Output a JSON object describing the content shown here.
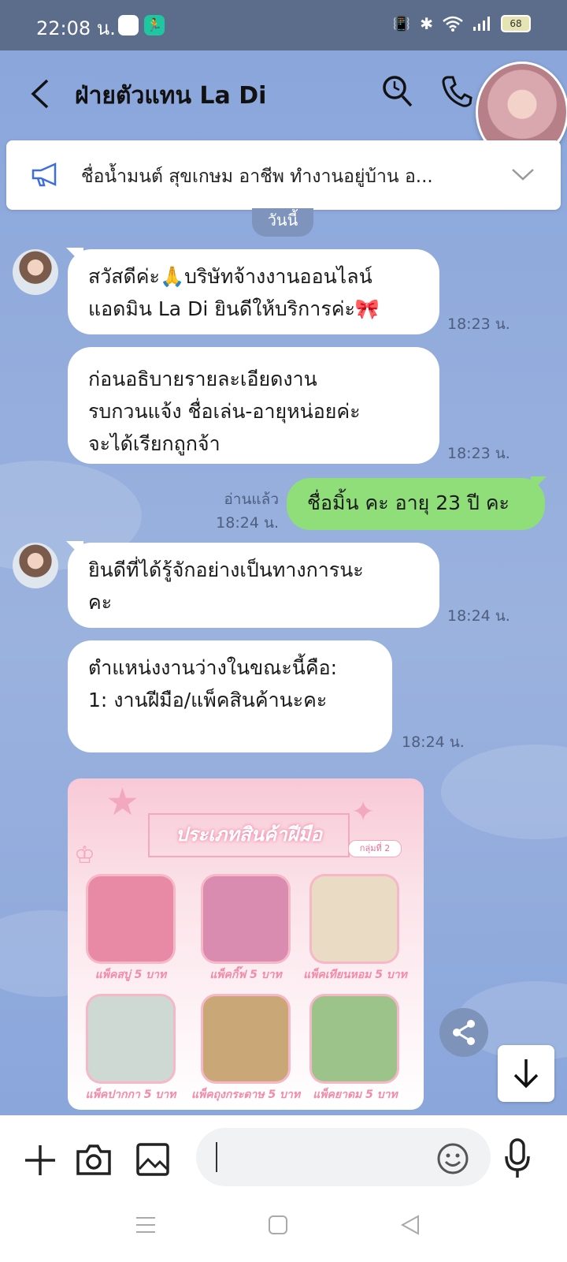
{
  "status_bar": {
    "time": "22:08 น.",
    "battery": "68"
  },
  "header": {
    "title": "ฝ่ายตัวแทน La Di"
  },
  "announcement": {
    "text": "ชื่อน้ำมนต์ สุขเกษม อาชีพ ทำงานอยู่บ้าน อ..."
  },
  "date_label": "วันนี้",
  "messages": [
    {
      "lines": [
        "สวัสดีค่ะ🙏บริษัทจ้างงานออนไลน์",
        "แอดมิน La Di  ยินดีให้บริการค่ะ🎀"
      ],
      "time": "18:23 น."
    },
    {
      "lines": [
        "ก่อนอธิบายรายละเอียดงาน",
        "รบกวนแจ้ง ชื่อเล่น-อายุหน่อยค่ะ",
        "จะได้เรียกถูกจ้า"
      ],
      "time": "18:23 น."
    },
    {
      "lines": [
        "ชื่อมิ้น คะ อายุ 23 ปี คะ"
      ],
      "time": "18:24 น.",
      "read_label": "อ่านแล้ว"
    },
    {
      "lines": [
        "ยินดีที่ได้รู้จักอย่างเป็นทางการนะ",
        "คะ"
      ],
      "time": "18:24 น."
    },
    {
      "lines": [
        "ตำแหน่งงานว่างในขณะนี้คือ:",
        "1: งานฝีมือ/แพ็คสินค้านะคะ"
      ],
      "time": "18:24 น."
    }
  ],
  "image_card": {
    "title": "ประเภทสินค้าฝีมือ",
    "tag": "กลุ่มที่ 2",
    "items": [
      {
        "label": "แพ็คสบู่ 5 บาท",
        "color": "#e88aa6"
      },
      {
        "label": "แพ็คกิ๊ฟ 5 บาท",
        "color": "#d98bb0"
      },
      {
        "label": "แพ็คเทียนหอม 5 บาท",
        "color": "#eadcc4"
      },
      {
        "label": "แพ็คปากกา 5 บาท",
        "color": "#cfd9d3"
      },
      {
        "label": "แพ็คถุงกระดาษ 5 บาท",
        "color": "#c9a776"
      },
      {
        "label": "แพ็คยาดม 5 บาท",
        "color": "#9cc48a"
      }
    ]
  },
  "input": {
    "placeholder": ""
  }
}
